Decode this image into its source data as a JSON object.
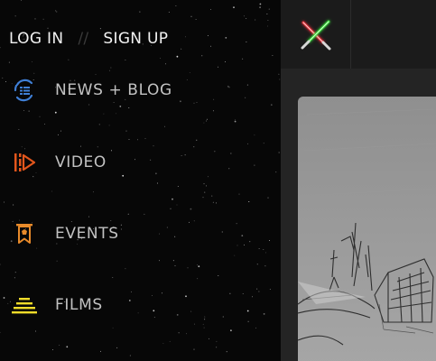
{
  "auth": {
    "login_label": "LOG IN",
    "separator": "//",
    "signup_label": "SIGN UP"
  },
  "nav": {
    "items": [
      {
        "label": "NEWS + BLOG",
        "icon": "news-blog-icon",
        "icon_color": "#3f7fd6"
      },
      {
        "label": "VIDEO",
        "icon": "video-icon",
        "icon_color": "#e2561c"
      },
      {
        "label": "EVENTS",
        "icon": "events-icon",
        "icon_color": "#e88a2a"
      },
      {
        "label": "FILMS",
        "icon": "films-icon",
        "icon_color": "#f0dc2a"
      }
    ]
  },
  "header": {
    "logo_icon": "crossed-lightsabers-icon",
    "saber_colors": [
      "#e0303a",
      "#37d83a"
    ]
  },
  "colors": {
    "drawer_bg": "#070707",
    "label_text": "#c2c2c2",
    "auth_text": "#f2f2f2",
    "header_bg": "#1b1b1b",
    "content_bg": "#242424"
  }
}
